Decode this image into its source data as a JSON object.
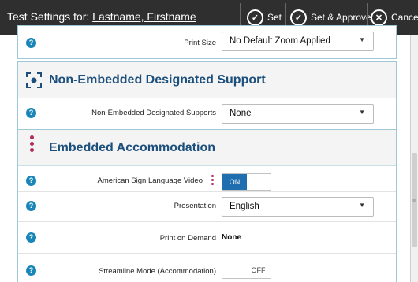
{
  "titlebar": {
    "prefix": "Test Settings for: ",
    "student_name": "Lastname, Firstname",
    "set_label": "Set",
    "set_approve_label": "Set & Approve",
    "cancel_label": "Cancel"
  },
  "top_row": {
    "label": "Print Size",
    "value": "No Default Zoom Applied"
  },
  "sections": {
    "non_embedded": {
      "title": "Non-Embedded Designated Support",
      "row_label": "Non-Embedded Designated Supports",
      "row_value": "None"
    },
    "embedded": {
      "title": "Embedded Accommodation",
      "rows": {
        "asl": {
          "label": "American Sign Language Video",
          "toggle": "ON"
        },
        "presentation": {
          "label": "Presentation",
          "value": "English"
        },
        "print_on_demand": {
          "label": "Print on Demand",
          "value": "None"
        },
        "streamline": {
          "label": "Streamline Mode (Accommodation)",
          "toggle": "OFF"
        }
      }
    }
  },
  "colors": {
    "accent": "#1c4f7c",
    "help": "#1a86b8",
    "toggle_on": "#1f6fb0",
    "embedded_marker": "#b02a5b"
  }
}
